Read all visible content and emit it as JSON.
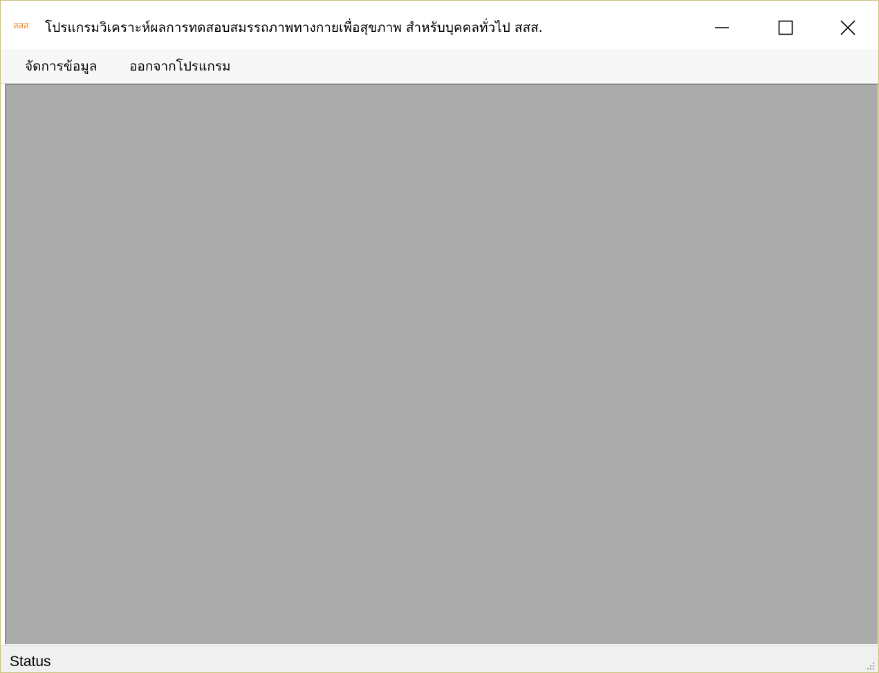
{
  "window": {
    "app_icon_text": "สสส",
    "title": "โปรแกรมวิเคราะห์ผลการทดสอบสมรรถภาพทางกายเพื่อสุขภาพ สำหรับบุคคลทั่วไป สสส.",
    "accent_color": "#e8893a"
  },
  "menu": {
    "items": [
      {
        "label": "จัดการข้อมูล"
      },
      {
        "label": "ออกจากโปรแกรม"
      }
    ]
  },
  "client_area": {
    "background": "#ababab"
  },
  "statusbar": {
    "text": "Status"
  },
  "icons": {
    "minimize": "minimize-icon",
    "maximize": "maximize-icon",
    "close": "close-icon",
    "size_grip": "size-grip-icon"
  }
}
